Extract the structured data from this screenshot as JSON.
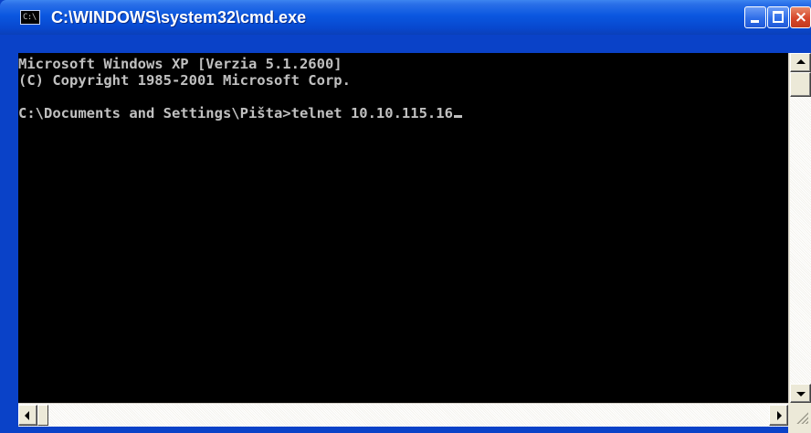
{
  "window": {
    "title": "C:\\WINDOWS\\system32\\cmd.exe",
    "icon_text": "C:\\",
    "icon": "console-app-icon"
  },
  "titlebar_buttons": {
    "minimize": "minimize-icon",
    "maximize": "maximize-icon",
    "close": "close-icon",
    "close_glyph": "×"
  },
  "console": {
    "lines": [
      "Microsoft Windows XP [Verzia 5.1.2600]",
      "(C) Copyright 1985-2001 Microsoft Corp.",
      "",
      "C:\\Documents and Settings\\Pišta>telnet 10.10.115.16"
    ],
    "text_color": "#c0c0c0",
    "background_color": "#000000"
  },
  "colors": {
    "title_blue": "#0a57e0",
    "frame_blue": "#0a42c8",
    "close_red": "#d6472a",
    "scrollbar_face": "#ece9d8"
  }
}
